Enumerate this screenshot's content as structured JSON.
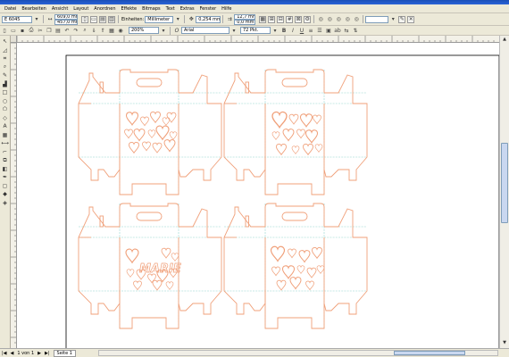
{
  "menu": [
    {
      "label": "Datei"
    },
    {
      "label": "Bearbeiten"
    },
    {
      "label": "Ansicht"
    },
    {
      "label": "Layout"
    },
    {
      "label": "Anordnen"
    },
    {
      "label": "Effekte"
    },
    {
      "label": "Bitmaps"
    },
    {
      "label": "Text"
    },
    {
      "label": "Extras"
    },
    {
      "label": "Fenster"
    },
    {
      "label": "Hilfe"
    }
  ],
  "propertybar": {
    "paper_size": "E 6045",
    "width": "609,0 mm",
    "height": "457,0 mm",
    "units_label": "Einheiten:",
    "units_value": "Millimeter",
    "nudge": "0,254 mm",
    "dup_x": "12,7 mm",
    "dup_y": "0,0 mm"
  },
  "standardbar": {
    "zoom": "200%",
    "font": "Arial",
    "font_size": "72 Pkt."
  },
  "status": {
    "page_counter": "1 von 1",
    "page_tab": "Seite 1"
  },
  "colors": {
    "cutline": "#f0a07a",
    "foldline": "#8fd4cc",
    "marie_text": "#f0a07a"
  },
  "design": {
    "name_text": "MARIE"
  }
}
